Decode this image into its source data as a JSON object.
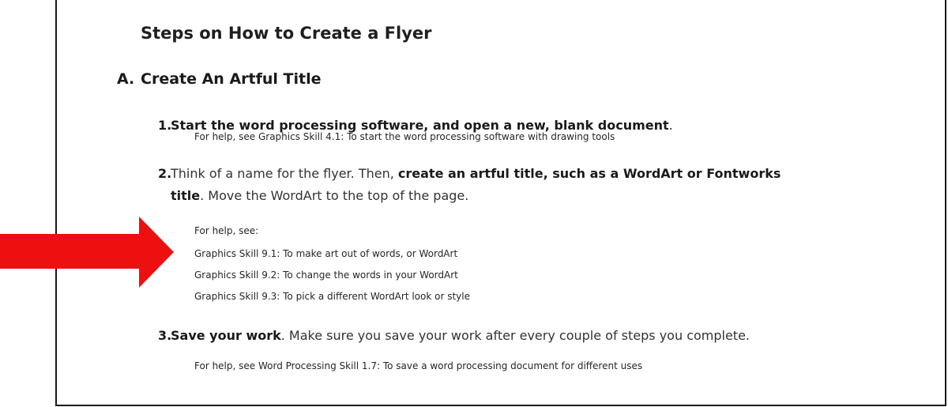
{
  "title": "Steps on How to Create a Flyer",
  "section": {
    "letter": "A.",
    "heading": "Create An Artful Title"
  },
  "steps": [
    {
      "number": "1.",
      "bold_text": "Start the word processing software, and open a new, blank document",
      "tail_text": ".",
      "help": "For help, see Graphics Skill 4.1: To start the word processing software with drawing tools"
    },
    {
      "number": "2.",
      "lead_text": "Think of a name for the flyer. Then,",
      "bold_text": "create an artful title, such as a WordArt or Fontworks title",
      "tail_text": ". Move the WordArt to the top of the page.",
      "help_intro": "For help, see:",
      "help_items": [
        "Graphics Skill 9.1: To make art out of words, or WordArt",
        "Graphics Skill 9.2: To change the words in your WordArt",
        "Graphics Skill 9.3:  To pick a different WordArt look or style"
      ]
    },
    {
      "number": "3.",
      "bold_text": "Save your work",
      "tail_text": ". Make sure you save your work after every couple of steps you complete.",
      "help": "For help, see Word Processing Skill 1.7: To save a word processing document for different uses"
    }
  ],
  "colors": {
    "arrow": "#ee1010"
  }
}
